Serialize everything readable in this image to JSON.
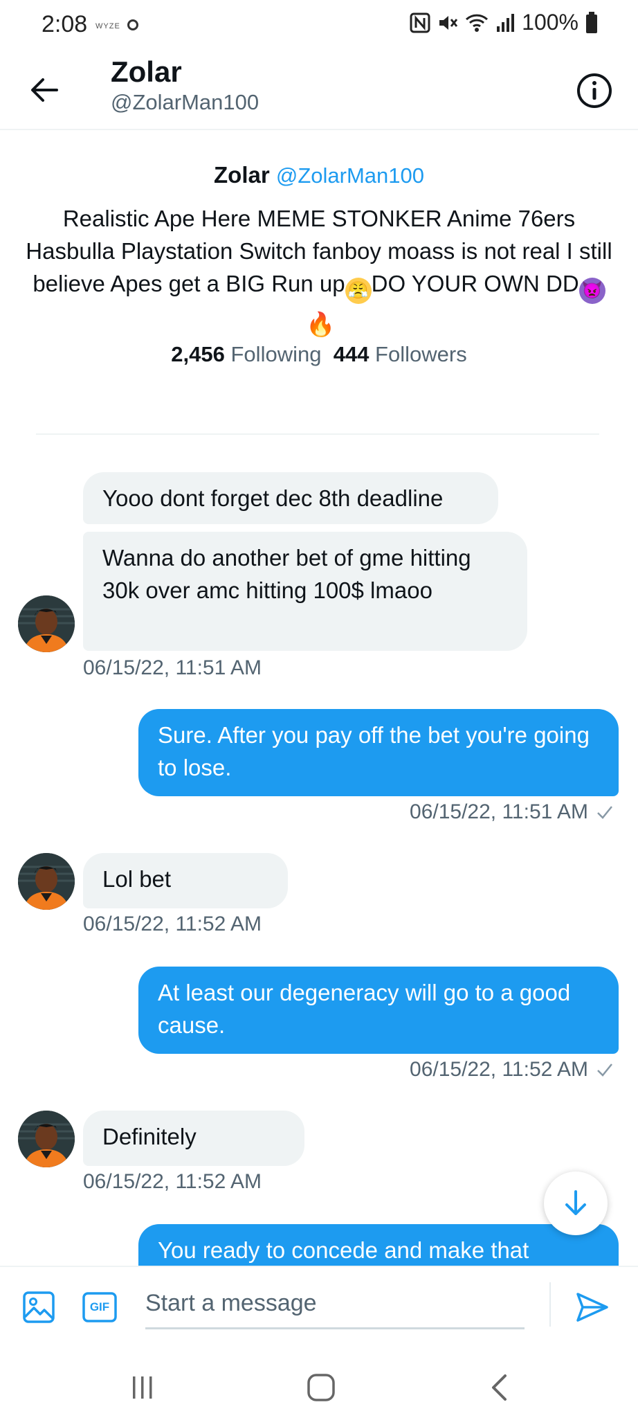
{
  "status_bar": {
    "time": "2:08",
    "carrier": "WYZE",
    "battery": "100%"
  },
  "header": {
    "name": "Zolar",
    "handle": "@ZolarMan100",
    "back_icon": "back-arrow-icon",
    "info_icon": "info-icon"
  },
  "profile": {
    "name": "Zolar",
    "handle": "@ZolarMan100",
    "bio_part1": "Realistic Ape Here MEME STONKER Anime 76ers Hasbulla Playstation Switch fanboy moass is not real I still believe Apes get a BIG Run up",
    "bio_part2": "DO YOUR OWN DD",
    "emoji_1": "steam-face-emoji",
    "emoji_2": "devil-emoji",
    "emoji_3": "fire-emoji",
    "following_count": "2,456",
    "following_label": "Following",
    "followers_count": "444",
    "followers_label": "Followers"
  },
  "messages": [
    {
      "direction": "in",
      "text": "Yooo dont forget dec 8th deadline"
    },
    {
      "direction": "in",
      "text": "Wanna do another bet of gme hitting 30k over amc hitting 100$ lmaoo",
      "time": "06/15/22, 11:51 AM"
    },
    {
      "direction": "out",
      "text": "Sure. After you pay off the bet you're going to lose.",
      "time": "06/15/22, 11:51 AM"
    },
    {
      "direction": "in",
      "text": "Lol bet",
      "time": "06/15/22, 11:52 AM"
    },
    {
      "direction": "out",
      "text": "At least our degeneracy will go to a good cause.",
      "time": "06/15/22, 11:52 AM"
    },
    {
      "direction": "in",
      "text": "Definitely",
      "time": "06/15/22, 11:52 AM"
    },
    {
      "direction": "out",
      "text": "You ready to concede and make that"
    }
  ],
  "composer": {
    "placeholder": "Start a message",
    "gif_label": "GIF"
  },
  "colors": {
    "accent": "#1d9bf0",
    "incoming_bubble": "#eff3f4",
    "secondary_text": "#536471"
  }
}
